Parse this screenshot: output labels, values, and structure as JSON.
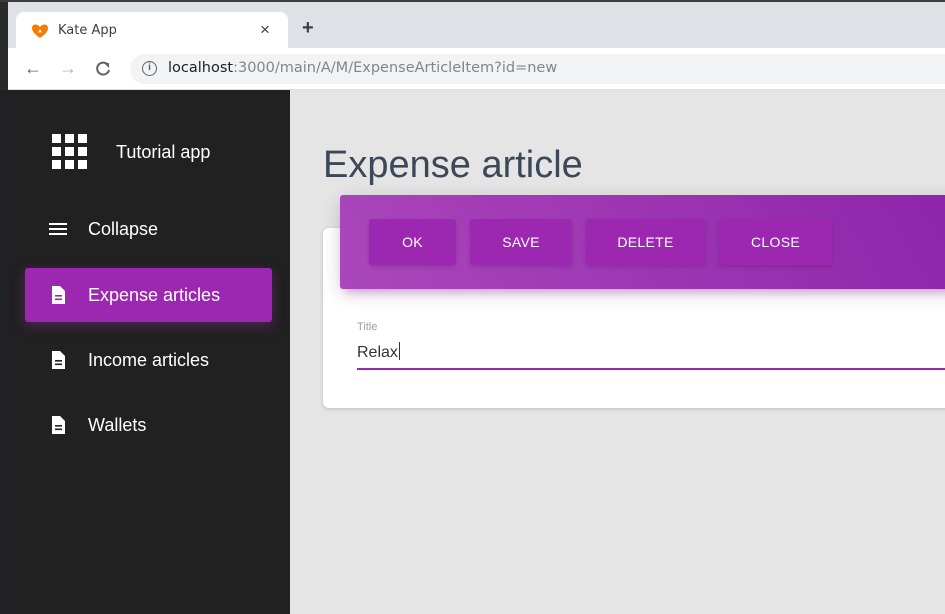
{
  "browser": {
    "tab_title": "Kate App",
    "tab_close": "×",
    "new_tab": "+",
    "url_host": "localhost",
    "url_path": ":3000/main/A/M/ExpenseArticleItem?id=new",
    "back": "←",
    "forward": "→",
    "reload": "C"
  },
  "sidebar": {
    "app_title": "Tutorial app",
    "items": [
      {
        "label": "Collapse",
        "icon": "menu-icon"
      },
      {
        "label": "Expense articles",
        "icon": "document-icon",
        "active": true
      },
      {
        "label": "Income articles",
        "icon": "document-icon"
      },
      {
        "label": "Wallets",
        "icon": "document-icon"
      }
    ]
  },
  "main": {
    "page_title": "Expense article",
    "buttons": [
      "OK",
      "SAVE",
      "DELETE",
      "CLOSE"
    ],
    "field": {
      "label": "Title",
      "value": "Relax"
    }
  },
  "colors": {
    "accent": "#9c27b0",
    "sidebar_bg": "#212121",
    "main_bg": "#e5e5e5"
  }
}
